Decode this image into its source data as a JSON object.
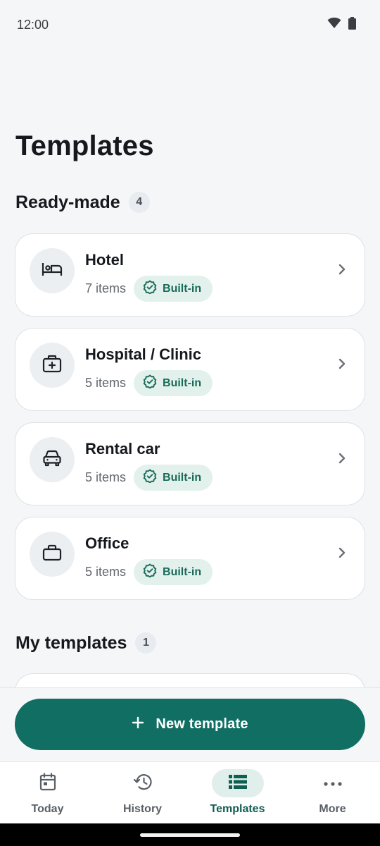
{
  "status_bar": {
    "time": "12:00"
  },
  "header": {
    "title": "Templates"
  },
  "ready_made": {
    "title": "Ready-made",
    "count": "4",
    "items": [
      {
        "title": "Hotel",
        "count": "7 items",
        "badge": "Built-in",
        "icon": "bed-icon"
      },
      {
        "title": "Hospital / Clinic",
        "count": "5 items",
        "badge": "Built-in",
        "icon": "medical-kit-icon"
      },
      {
        "title": "Rental car",
        "count": "5 items",
        "badge": "Built-in",
        "icon": "car-icon"
      },
      {
        "title": "Office",
        "count": "5 items",
        "badge": "Built-in",
        "icon": "briefcase-icon"
      }
    ]
  },
  "my_templates": {
    "title": "My templates",
    "count": "1"
  },
  "fab": {
    "label": "New template",
    "icon": "plus-icon"
  },
  "bottom_nav": {
    "items": [
      {
        "label": "Today",
        "icon": "calendar-icon",
        "active": false
      },
      {
        "label": "History",
        "icon": "history-icon",
        "active": false
      },
      {
        "label": "Templates",
        "icon": "list-icon",
        "active": true
      },
      {
        "label": "More",
        "icon": "more-icon",
        "active": false
      }
    ]
  },
  "colors": {
    "accent": "#106f62",
    "badge_bg": "#e3f1ec",
    "badge_text": "#1a6b5a",
    "background": "#f5f6f8"
  }
}
